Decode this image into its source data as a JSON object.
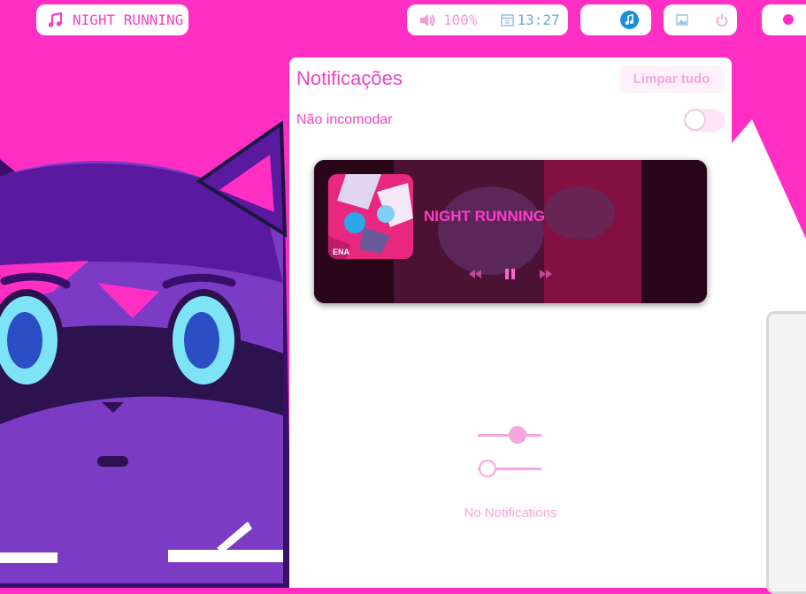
{
  "bar": {
    "now_playing": "NIGHT RUNNING",
    "volume": "100%",
    "clock": "13:27"
  },
  "panel": {
    "title": "Notificações",
    "clear_button": "Limpar tudo",
    "dnd_label": "Não incomodar",
    "dnd_enabled": false,
    "media": {
      "title": "NIGHT RUNNING",
      "album_art_text": "ENA"
    },
    "sliders": [
      0.62,
      0.15
    ],
    "empty_text": "No Notifications"
  },
  "colors": {
    "wallpaper": "#ff2fc4",
    "accent": "#ee44c8",
    "muted_pink": "#f7a6dd",
    "character_purple": "#7b3bc4"
  },
  "icons": [
    "music-note-icon",
    "volume-icon",
    "calendar-icon",
    "music-app-icon",
    "image-icon",
    "power-icon",
    "record-dot-icon",
    "rewind-icon",
    "pause-icon",
    "fast-forward-icon"
  ]
}
